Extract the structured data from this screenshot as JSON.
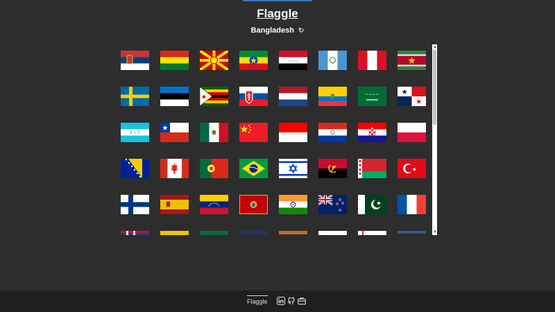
{
  "app": {
    "title": "Flaggle",
    "target_country": "Bangladesh",
    "refresh_icon": "refresh-icon"
  },
  "footer": {
    "name": "Flaggle",
    "icons": [
      "linkedin-icon",
      "github-icon",
      "briefcase-icon"
    ]
  },
  "colors": {
    "background": "#2d2d2d",
    "footer": "#1f1f1f"
  },
  "flags": [
    "serbia",
    "bolivia",
    "north-macedonia",
    "ethiopia",
    "iraq",
    "guatemala",
    "peru",
    "suriname",
    "sweden",
    "estonia",
    "zimbabwe",
    "slovakia",
    "netherlands",
    "ecuador",
    "saudi-arabia",
    "panama",
    "honduras",
    "chile",
    "mexico",
    "china",
    "indonesia",
    "paraguay",
    "croatia",
    "poland",
    "bosnia-herzegovina",
    "canada",
    "portugal",
    "brazil",
    "israel",
    "angola",
    "belarus",
    "turkey",
    "finland",
    "spain",
    "venezuela",
    "montenegro",
    "india",
    "new-zealand",
    "pakistan",
    "france",
    "partial-flag-1",
    "partial-flag-2",
    "partial-flag-3",
    "partial-flag-4",
    "partial-flag-5",
    "partial-flag-6",
    "partial-flag-7",
    "partial-flag-8"
  ]
}
